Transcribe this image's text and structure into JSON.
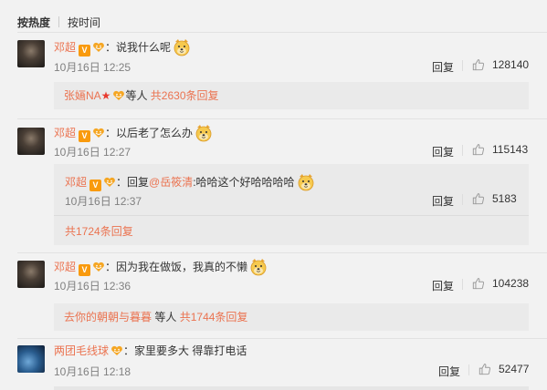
{
  "tabs": [
    {
      "label": "按热度",
      "active": true
    },
    {
      "label": "按时间",
      "active": false
    }
  ],
  "colors": {
    "accent": "#eb7350",
    "vip": "#f99a0d",
    "muted": "#808080"
  },
  "reply_label": "回复",
  "comments": [
    {
      "user": "邓超",
      "text": "：说我什么呢",
      "time": "10月16日 12:25",
      "likes": "128140",
      "summary": {
        "names": "张婳NA",
        "middle": "等人",
        "count": "共2630条回复"
      }
    },
    {
      "user": "邓超",
      "text": "：以后老了怎么办",
      "time": "10月16日 12:27",
      "likes": "115143",
      "reply": {
        "user": "邓超",
        "prefix": "：回复",
        "mention": "@岳筱清",
        "text": ":哈哈这个好哈哈哈哈",
        "time": "10月16日 12:37",
        "likes": "5183"
      },
      "summary": {
        "count": "共1724条回复"
      }
    },
    {
      "user": "邓超",
      "text": "：因为我在做饭，我真的不懒",
      "time": "10月16日 12:36",
      "likes": "104238",
      "summary": {
        "names": "去你的朝朝与暮暮",
        "middle": "等人",
        "count": "共1744条回复"
      }
    },
    {
      "user": "两团毛线球",
      "text": "：家里要多大  得靠打电话",
      "time": "10月16日 12:18",
      "likes": "52477"
    }
  ]
}
